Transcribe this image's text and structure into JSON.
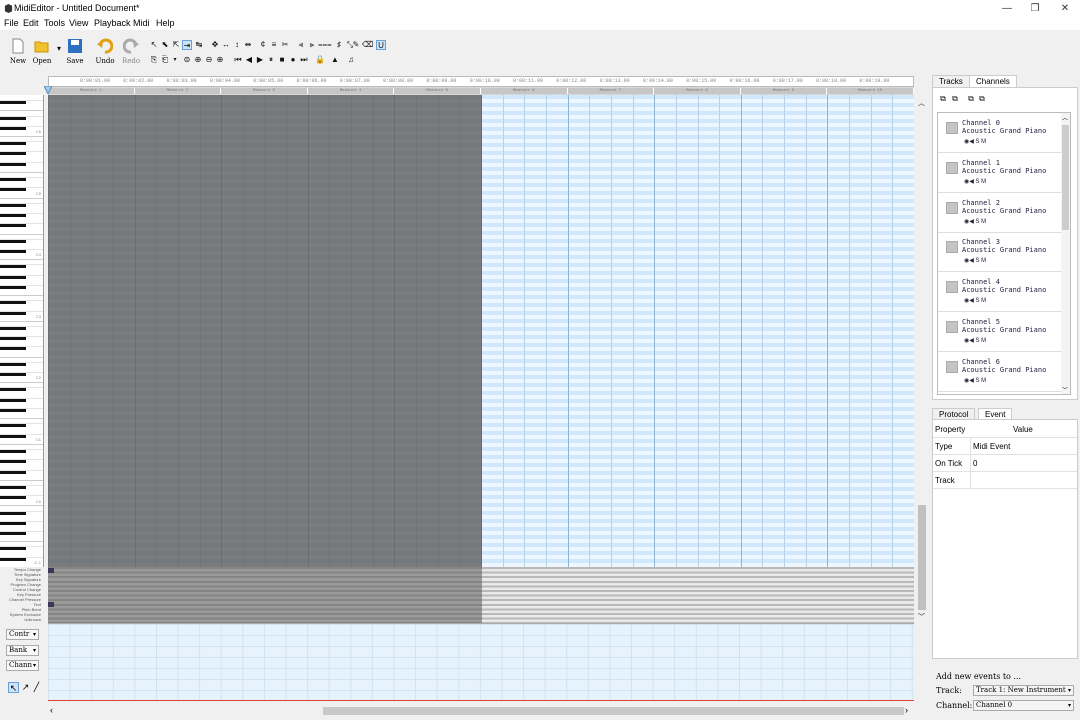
{
  "window": {
    "title": "MidiEditor - Untitled Document*",
    "min": "—",
    "max": "❐",
    "close": "✕"
  },
  "menu": [
    "File",
    "Edit",
    "Tools",
    "View",
    "Playback",
    "Midi",
    "Help"
  ],
  "toolbar": {
    "new": "New",
    "open": "Open",
    "save": "Save",
    "undo": "Undo",
    "redo": "Redo"
  },
  "timeline": [
    "0:00:01.00",
    "0:00:02.00",
    "0:00:03.00",
    "0:00:04.00",
    "0:00:05.00",
    "0:00:06.00",
    "0:00:07.00",
    "0:00:08.00",
    "0:00:09.00",
    "0:00:10.00",
    "0:00:11.00",
    "0:00:12.00",
    "0:00:13.00",
    "0:00:14.00",
    "0:00:15.00",
    "0:00:16.00",
    "0:00:17.00",
    "0:00:18.00",
    "0:00:19.00"
  ],
  "measures": [
    "Measure 1",
    "Measure 2",
    "Measure 3",
    "Measure 4",
    "Measure 5",
    "Measure 6",
    "Measure 7",
    "Measure 8",
    "Measure 9",
    "Measure 10"
  ],
  "octaves": [
    "C6",
    "C5",
    "C4",
    "C3",
    "C2",
    "C1",
    "C0",
    "C-1"
  ],
  "event_lanes": [
    "Tempo Change",
    "Time Signature",
    "Key Signature",
    "Program Change",
    "Control Change",
    "Key Pressure",
    "Channel Pressure",
    "Text",
    "Pitch Bend",
    "System Exclusive",
    "Unknown"
  ],
  "lower_controls": {
    "combos": [
      "Contr",
      "Bank",
      "Chann"
    ],
    "tools": [
      "↖",
      "↗",
      "╱"
    ]
  },
  "right_panel": {
    "tabs": [
      "Tracks",
      "Channels"
    ],
    "channels": [
      {
        "name": "Channel 0",
        "instrument": "Acoustic Grand Piano",
        "controls": "◉◀ S  M"
      },
      {
        "name": "Channel 1",
        "instrument": "Acoustic Grand Piano",
        "controls": "◉◀ S  M"
      },
      {
        "name": "Channel 2",
        "instrument": "Acoustic Grand Piano",
        "controls": "◉◀ S  M"
      },
      {
        "name": "Channel 3",
        "instrument": "Acoustic Grand Piano",
        "controls": "◉◀ S  M"
      },
      {
        "name": "Channel 4",
        "instrument": "Acoustic Grand Piano",
        "controls": "◉◀ S  M"
      },
      {
        "name": "Channel 5",
        "instrument": "Acoustic Grand Piano",
        "controls": "◉◀ S  M"
      },
      {
        "name": "Channel 6",
        "instrument": "Acoustic Grand Piano",
        "controls": "◉◀ S  M"
      }
    ],
    "bottom_tabs": [
      "Protocol",
      "Event"
    ],
    "properties": {
      "header": {
        "key": "Property",
        "value": "Value"
      },
      "rows": [
        {
          "key": "Type",
          "value": "Midi Event"
        },
        {
          "key": "On Tick",
          "value": "0"
        },
        {
          "key": "Track",
          "value": ""
        }
      ]
    },
    "add_events": {
      "label": "Add new events to ...",
      "track_label": "Track:",
      "track_value": "Track 1: New Instrument",
      "channel_label": "Channel:",
      "channel_value": "Channel 0"
    }
  },
  "colors": {
    "grid_light": "#eef7ff",
    "grid_dark": "#cfe8fb",
    "shade": "#5a5a5a",
    "accent": "#1e6fc0"
  }
}
